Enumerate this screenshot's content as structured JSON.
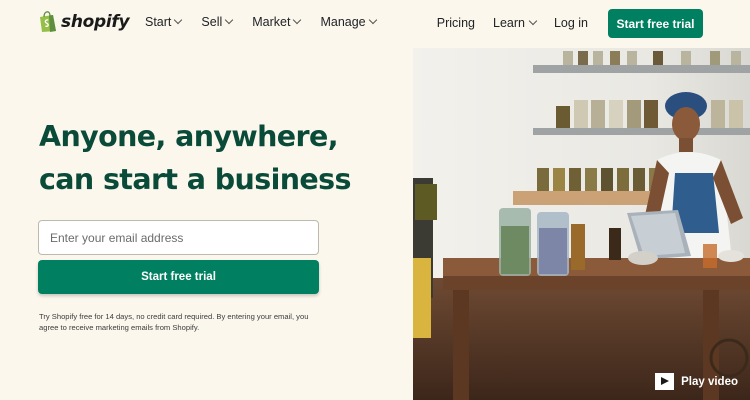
{
  "brand": {
    "name": "shopify",
    "accent": "#008060",
    "headline_color": "#0a4a38",
    "background": "#fbf7ed"
  },
  "nav": {
    "menu": [
      {
        "label": "Start",
        "icon": "chevron-down-icon"
      },
      {
        "label": "Sell",
        "icon": "chevron-down-icon"
      },
      {
        "label": "Market",
        "icon": "chevron-down-icon"
      },
      {
        "label": "Manage",
        "icon": "chevron-down-icon"
      }
    ],
    "pricing": "Pricing",
    "learn": "Learn",
    "login": "Log in",
    "cta": "Start free trial"
  },
  "hero": {
    "headline_line1": "Anyone, anywhere,",
    "headline_line2": "can start a business",
    "email_placeholder": "Enter your email address",
    "email_value": "",
    "cta": "Start free trial",
    "disclaimer": "Try Shopify free for 14 days, no credit card required. By entering your email, you agree to receive marketing emails from Shopify."
  },
  "media": {
    "play_label": "Play video",
    "play_icon": "play-icon"
  }
}
